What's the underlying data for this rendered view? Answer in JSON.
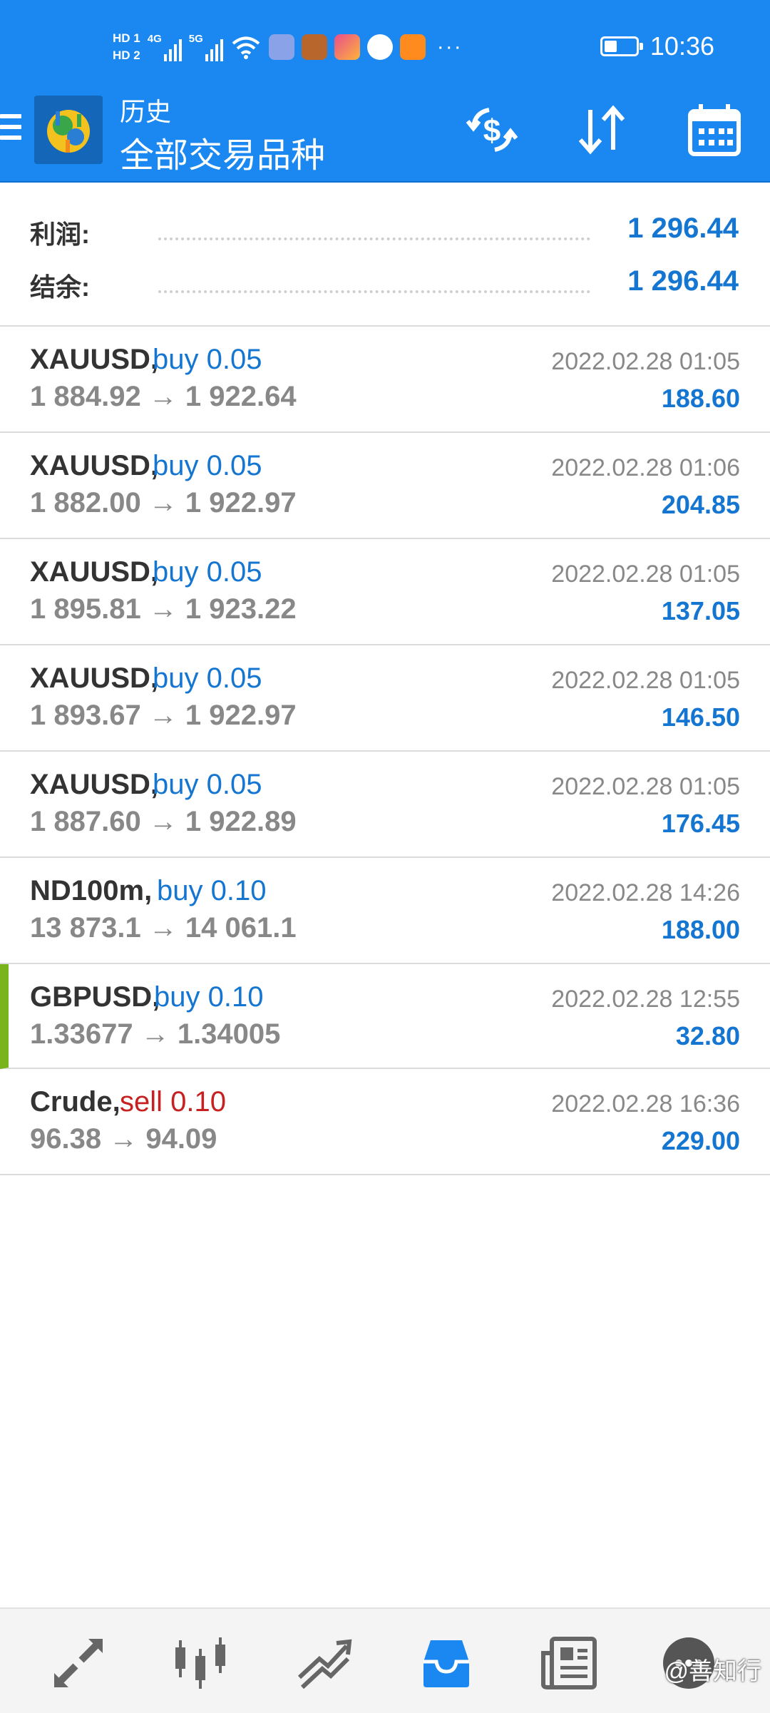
{
  "status_bar": {
    "hd1": "HD 1",
    "hd2": "HD 2",
    "net1": "4G",
    "net2": "5G",
    "more": "···",
    "battery_level": 0.4,
    "time": "10:36"
  },
  "toolbar": {
    "subtitle": "历史",
    "title": "全部交易品种"
  },
  "summary": {
    "profit_label": "利润:",
    "profit_value": "1 296.44",
    "balance_label": "结余:",
    "balance_value": "1 296.44"
  },
  "deals": [
    {
      "symbol": "XAUUSD,",
      "direction": "buy 0.05",
      "type": "buy",
      "prices": "1 884.92 → 1 922.64",
      "time": "2022.02.28 01:05",
      "profit": "188.60"
    },
    {
      "symbol": "XAUUSD,",
      "direction": "buy 0.05",
      "type": "buy",
      "prices": "1 882.00 → 1 922.97",
      "time": "2022.02.28 01:06",
      "profit": "204.85"
    },
    {
      "symbol": "XAUUSD,",
      "direction": "buy 0.05",
      "type": "buy",
      "prices": "1 895.81 → 1 923.22",
      "time": "2022.02.28 01:05",
      "profit": "137.05"
    },
    {
      "symbol": "XAUUSD,",
      "direction": "buy 0.05",
      "type": "buy",
      "prices": "1 893.67 → 1 922.97",
      "time": "2022.02.28 01:05",
      "profit": "146.50"
    },
    {
      "symbol": "XAUUSD,",
      "direction": "buy 0.05",
      "type": "buy",
      "prices": "1 887.60 → 1 922.89",
      "time": "2022.02.28 01:05",
      "profit": "176.45"
    },
    {
      "symbol": "ND100m,",
      "direction": "buy 0.10",
      "type": "buy",
      "prices": "13 873.1 → 14 061.1",
      "time": "2022.02.28 14:26",
      "profit": "188.00"
    },
    {
      "symbol": "GBPUSD,",
      "direction": "buy 0.10",
      "type": "buy",
      "prices": "1.33677 → 1.34005",
      "time": "2022.02.28 12:55",
      "profit": "32.80"
    },
    {
      "symbol": "Crude,",
      "direction": "sell 0.10",
      "type": "sell",
      "prices": "96.38 → 94.09",
      "time": "2022.02.28 16:36",
      "profit": "229.00"
    }
  ],
  "bottom_nav": {
    "items": [
      "quotes-icon",
      "chart-icon",
      "trade-icon",
      "history-icon",
      "news-icon",
      "messages-icon"
    ],
    "active": "history-icon"
  },
  "watermark": "@善知行",
  "colors": {
    "primary": "#1a88f0",
    "profit": "#1576d2",
    "sell": "#c62020",
    "marker": "#79b41c"
  }
}
